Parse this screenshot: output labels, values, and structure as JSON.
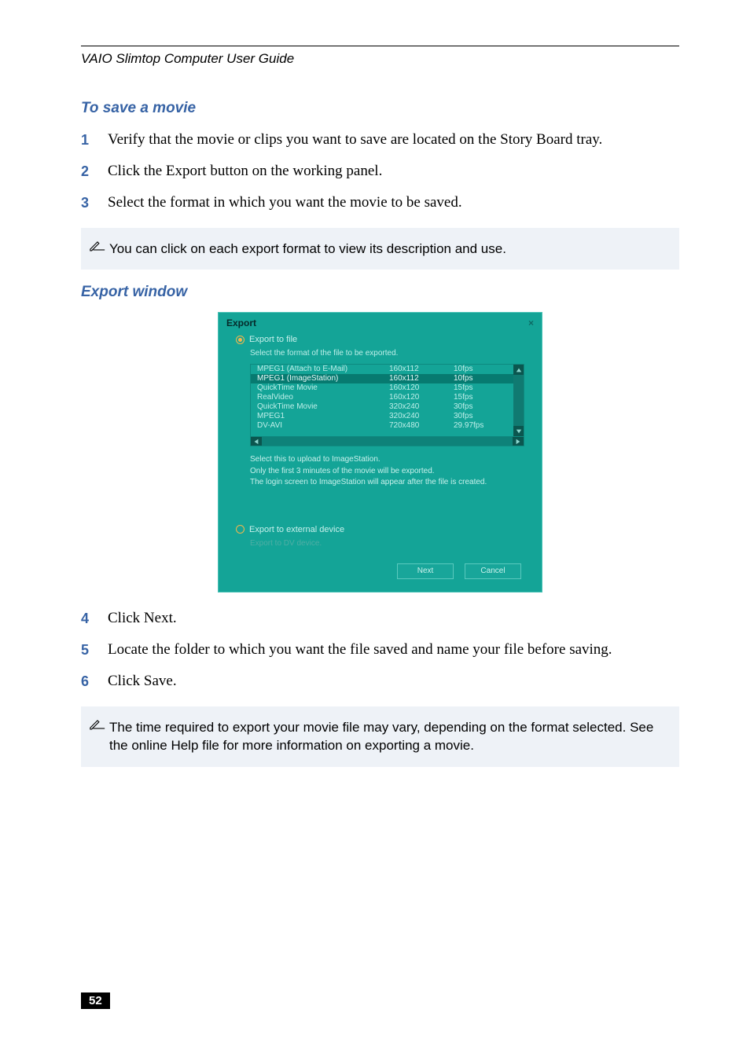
{
  "header": {
    "doc_title": "VAIO Slimtop Computer User Guide"
  },
  "sections": {
    "save_movie_heading": "To save a movie",
    "export_window_heading": "Export window"
  },
  "steps_top": [
    {
      "num": "1",
      "text": "Verify that the movie or clips you want to save are located on the Story Board tray."
    },
    {
      "num": "2",
      "text": "Click the Export button on the working panel."
    },
    {
      "num": "3",
      "text": "Select the format in which you want the movie to be saved."
    }
  ],
  "note1": {
    "text": "You can click on each export format to view its description and use."
  },
  "export_window": {
    "title": "Export",
    "close_glyph": "×",
    "radio_file_label": "Export to file",
    "select_format_label": "Select the format of the file to be exported.",
    "formats": [
      {
        "name": "MPEG1 (Attach to E-Mail)",
        "res": "160x112",
        "fps": "10fps",
        "selected": false
      },
      {
        "name": "MPEG1 (ImageStation)",
        "res": "160x112",
        "fps": "10fps",
        "selected": true
      },
      {
        "name": "QuickTime Movie",
        "res": "160x120",
        "fps": "15fps",
        "selected": false
      },
      {
        "name": "RealVideo",
        "res": "160x120",
        "fps": "15fps",
        "selected": false
      },
      {
        "name": "QuickTime Movie",
        "res": "320x240",
        "fps": "30fps",
        "selected": false
      },
      {
        "name": "MPEG1",
        "res": "320x240",
        "fps": "30fps",
        "selected": false
      },
      {
        "name": "DV-AVI",
        "res": "720x480",
        "fps": "29.97fps",
        "selected": false
      }
    ],
    "desc_lines": [
      "Select this to upload to ImageStation.",
      "Only the first 3 minutes of the movie will be exported.",
      "The login screen to ImageStation will appear after the file is created."
    ],
    "radio_device_label": "Export to external device",
    "device_sub_label": "Export to DV device.",
    "next_label": "Next",
    "cancel_label": "Cancel"
  },
  "steps_bottom": [
    {
      "num": "4",
      "text": "Click Next."
    },
    {
      "num": "5",
      "text": "Locate the folder to which you want the file saved and name your file before saving."
    },
    {
      "num": "6",
      "text": "Click Save."
    }
  ],
  "note2": {
    "text": "The time required to export your movie file may vary, depending on the format selected. See the online Help file for more information on exporting a movie."
  },
  "page_number": "52"
}
